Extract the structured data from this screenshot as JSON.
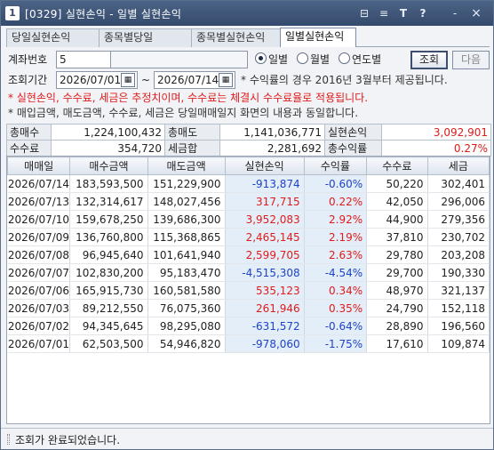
{
  "window": {
    "app_badge": "1",
    "title": "[0329] 실현손익 - 일별 실현손익",
    "controls": [
      "⊟",
      "≡",
      "T",
      "?",
      "-",
      "×"
    ]
  },
  "tabs": [
    {
      "label": "당일실현손익",
      "active": false
    },
    {
      "label": "종목별당일",
      "active": false
    },
    {
      "label": "종목별실현손익",
      "active": false
    },
    {
      "label": "일별실현손익",
      "active": true
    }
  ],
  "account": {
    "label": "계좌번호",
    "value": "5",
    "name_value": ""
  },
  "period_view": {
    "options": [
      {
        "label": "일별",
        "selected": true
      },
      {
        "label": "월별",
        "selected": false
      },
      {
        "label": "연도별",
        "selected": false
      }
    ]
  },
  "buttons": {
    "query": "조회",
    "next": "다음"
  },
  "period": {
    "label": "조회기간",
    "start": "2026/07/01",
    "end": "2026/07/14",
    "separator": "~",
    "calendar_glyph": "▦",
    "notice": "* 수익률의 경우 2016년 3월부터 제공됩니다."
  },
  "notes": {
    "red": "* 실현손익, 수수료, 세금은 추정치이며, 수수료는 체결시 수수료율로 적용됩니다.",
    "gray": "* 매입금액, 매도금액, 수수료, 세금은 당일매매일지 화면의 내용과 동일합니다."
  },
  "summary": {
    "rows": [
      [
        {
          "label": "총매수",
          "value": "1,224,100,432"
        },
        {
          "label": "총매도",
          "value": "1,141,036,771"
        },
        {
          "label": "실현손익",
          "value": "3,092,901",
          "color": "#e01b1b"
        }
      ],
      [
        {
          "label": "수수료",
          "value": "354,720"
        },
        {
          "label": "세금합",
          "value": "2,281,692"
        },
        {
          "label": "총수익률",
          "value": "0.27%",
          "color": "#e01b1b"
        }
      ]
    ]
  },
  "table": {
    "headers": [
      "매매일",
      "매수금액",
      "매도금액",
      "실현손익",
      "수익률",
      "수수료",
      "세금"
    ],
    "rows": [
      {
        "date": "2026/07/14",
        "buy": "183,593,500",
        "sell": "151,229,900",
        "pnl": "-913,874",
        "rate": "-0.60%",
        "fee": "50,220",
        "tax": "302,401",
        "sign": "neg"
      },
      {
        "date": "2026/07/13",
        "buy": "132,314,617",
        "sell": "148,027,456",
        "pnl": "317,715",
        "rate": "0.22%",
        "fee": "42,050",
        "tax": "296,006",
        "sign": "pos"
      },
      {
        "date": "2026/07/10",
        "buy": "159,678,250",
        "sell": "139,686,300",
        "pnl": "3,952,083",
        "rate": "2.92%",
        "fee": "44,900",
        "tax": "279,356",
        "sign": "pos"
      },
      {
        "date": "2026/07/09",
        "buy": "136,760,800",
        "sell": "115,368,865",
        "pnl": "2,465,145",
        "rate": "2.19%",
        "fee": "37,810",
        "tax": "230,702",
        "sign": "pos"
      },
      {
        "date": "2026/07/08",
        "buy": "96,945,640",
        "sell": "101,641,940",
        "pnl": "2,599,705",
        "rate": "2.63%",
        "fee": "29,780",
        "tax": "203,208",
        "sign": "pos"
      },
      {
        "date": "2026/07/07",
        "buy": "102,830,200",
        "sell": "95,183,470",
        "pnl": "-4,515,308",
        "rate": "-4.54%",
        "fee": "29,700",
        "tax": "190,330",
        "sign": "neg"
      },
      {
        "date": "2026/07/06",
        "buy": "165,915,730",
        "sell": "160,581,580",
        "pnl": "535,123",
        "rate": "0.34%",
        "fee": "48,970",
        "tax": "321,137",
        "sign": "pos"
      },
      {
        "date": "2026/07/03",
        "buy": "89,212,550",
        "sell": "76,075,360",
        "pnl": "261,946",
        "rate": "0.35%",
        "fee": "24,790",
        "tax": "152,118",
        "sign": "pos"
      },
      {
        "date": "2026/07/02",
        "buy": "94,345,645",
        "sell": "98,295,080",
        "pnl": "-631,572",
        "rate": "-0.64%",
        "fee": "28,890",
        "tax": "196,560",
        "sign": "neg"
      },
      {
        "date": "2026/07/01",
        "buy": "62,503,500",
        "sell": "54,946,820",
        "pnl": "-978,060",
        "rate": "-1.75%",
        "fee": "17,610",
        "tax": "109,874",
        "sign": "neg"
      }
    ]
  },
  "status": {
    "message": "조회가 완료되었습니다."
  },
  "colors": {
    "positive": "#e01b1b",
    "negative": "#1e43c8",
    "highlight": "#e3eef9",
    "titlebar": "#354b6d"
  }
}
